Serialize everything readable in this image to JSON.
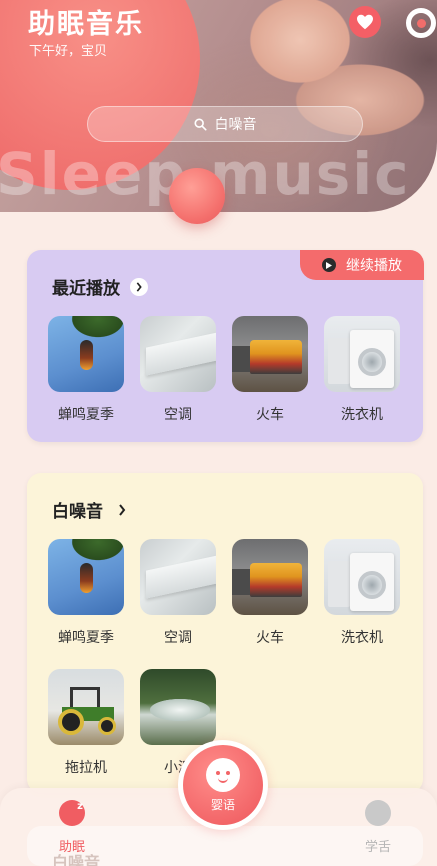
{
  "header": {
    "title": "助眠音乐",
    "subtitle": "下午好，宝贝",
    "watermark": "Sleep music",
    "icons": {
      "favorite": "heart-icon",
      "settings": "settings-ring-icon"
    }
  },
  "search": {
    "placeholder": "白噪音",
    "icon": "search-icon"
  },
  "recent": {
    "title": "最近播放",
    "continue_label": "继续播放",
    "items": [
      {
        "label": "蝉鸣夏季"
      },
      {
        "label": "空调"
      },
      {
        "label": "火车"
      },
      {
        "label": "洗衣机"
      }
    ]
  },
  "white_noise": {
    "title": "白噪音",
    "items": [
      {
        "label": "蝉鸣夏季"
      },
      {
        "label": "空调"
      },
      {
        "label": "火车"
      },
      {
        "label": "洗衣机"
      },
      {
        "label": "拖拉机"
      },
      {
        "label": "小溪"
      }
    ]
  },
  "next_section_peek": {
    "title": "白噪音"
  },
  "bottom_nav": {
    "sleep": {
      "label": "助眠",
      "icon": "moon-z-icon",
      "active": true
    },
    "center": {
      "label": "婴语",
      "icon": "baby-face-icon"
    },
    "learn": {
      "label": "学舌",
      "icon": "parrot-face-icon",
      "active": false
    }
  },
  "colors": {
    "accent": "#f26d6b",
    "recent_card": "#d8cbf2",
    "white_noise_card": "#fcf4d9",
    "background": "#fbece6"
  }
}
